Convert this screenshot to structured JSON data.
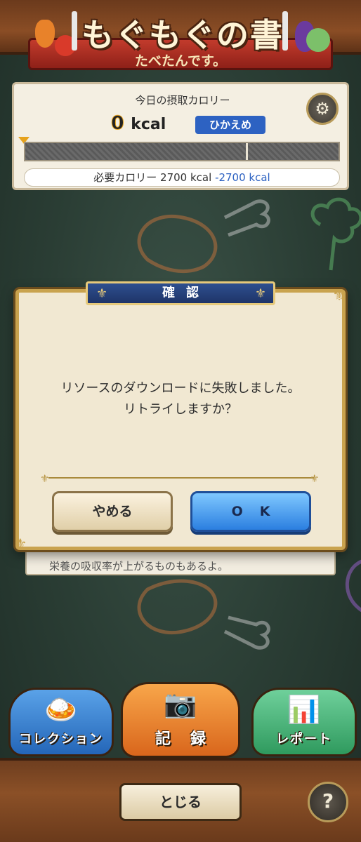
{
  "header": {
    "title": "もぐもぐの書",
    "subtitle": "たべたんです。"
  },
  "calorie_panel": {
    "label": "今日の摂取カロリー",
    "value": "0",
    "unit": "kcal",
    "badge": "ひかえめ",
    "required_label": "必要カロリー 2700 kcal",
    "required_diff": "-2700 kcal",
    "settings_icon": "gear-icon",
    "progress_fraction": 0
  },
  "hint": {
    "text": "栄養の吸収率が上がるものもあるよ。"
  },
  "dialog": {
    "title": "確認",
    "message_line1": "リソースのダウンロードに失敗しました。",
    "message_line2": "リトライしますか？",
    "cancel_label": "やめる",
    "ok_label": "OK"
  },
  "tabs": [
    {
      "label": "コレクション",
      "icon": "food-plate-icon"
    },
    {
      "label": "記録",
      "icon": "camera-icon"
    },
    {
      "label": "レポート",
      "icon": "bar-chart-icon"
    }
  ],
  "footer": {
    "close_label": "とじる",
    "help_label": "?"
  },
  "colors": {
    "dialog_title_bg": "#1e3468",
    "ok_button": "#2b7fe0",
    "calorie_badge": "#2d62c2",
    "chalkboard": "#2c3f36"
  }
}
